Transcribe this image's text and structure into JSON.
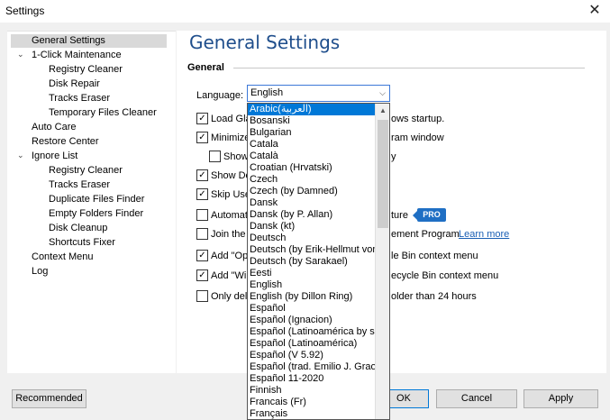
{
  "window": {
    "title": "Settings",
    "close_glyph": "✕"
  },
  "sidebar": {
    "items": [
      {
        "label": "General Settings",
        "selected": true
      },
      {
        "label": "1-Click Maintenance",
        "toggle": "⌄"
      },
      {
        "label": "Registry Cleaner"
      },
      {
        "label": "Disk Repair"
      },
      {
        "label": "Tracks Eraser"
      },
      {
        "label": "Temporary Files Cleaner"
      },
      {
        "label": "Auto Care"
      },
      {
        "label": "Restore Center"
      },
      {
        "label": "Ignore List",
        "toggle": "⌄"
      },
      {
        "label": "Registry Cleaner"
      },
      {
        "label": "Tracks Eraser"
      },
      {
        "label": "Duplicate Files Finder"
      },
      {
        "label": "Empty Folders Finder"
      },
      {
        "label": "Disk Cleanup"
      },
      {
        "label": "Shortcuts Fixer"
      },
      {
        "label": "Context Menu"
      },
      {
        "label": "Log"
      }
    ]
  },
  "main": {
    "title": "General Settings",
    "section": "General",
    "language_label": "Language:",
    "language_value": "English",
    "options": [
      {
        "text": "Load Gla",
        "tail": "ows startup.",
        "checked": true
      },
      {
        "text": "Minimize",
        "tail": "ram window",
        "checked": true
      },
      {
        "text": "Show",
        "tail": "y",
        "checked": false
      },
      {
        "text": "Show Do",
        "tail": "",
        "checked": true
      },
      {
        "text": "Skip Use",
        "tail": "",
        "checked": true
      },
      {
        "text": "Automat",
        "tail": "ture",
        "checked": false
      },
      {
        "text": "Join the",
        "tail": "ement Program",
        "link": "Learn more",
        "checked": false
      },
      {
        "text": "Add \"Op",
        "tail": "le Bin context menu",
        "checked": true
      },
      {
        "text": "Add \"Wip",
        "tail": "ecycle Bin context menu",
        "checked": true
      },
      {
        "text": "Only del",
        "tail": "older than 24 hours",
        "checked": false
      }
    ],
    "pro_badge": "PRO"
  },
  "language_options": [
    "Arabic(العربية)",
    "Bosanski",
    "Bulgarian",
    "Catala",
    "Català",
    "Croatian (Hrvatski)",
    "Czech",
    "Czech (by Damned)",
    "Dansk",
    "Dansk (by P. Allan)",
    "Dansk (kt)",
    "Deutsch",
    "Deutsch (by Erik-Hellmut von",
    "Deutsch (by Sarakael)",
    "Eesti",
    "English",
    "English (by Dillon Ring)",
    "Español",
    "Español (Ignacion)",
    "Español (Latinoamérica by sm",
    "Español (Latinoamérica)",
    "Español (V 5.92)",
    "Español (trad. Emilio J. Grao)",
    "Español 11-2020",
    "Finnish",
    "Francais (Fr)",
    "Français"
  ],
  "highlighted_language_index": 0,
  "buttons": {
    "recommended": "Recommended",
    "ok": "OK",
    "cancel": "Cancel",
    "apply": "Apply"
  },
  "colors": {
    "accent": "#1f4e8c",
    "highlight": "#0078d7",
    "pro": "#1f6fc4"
  }
}
